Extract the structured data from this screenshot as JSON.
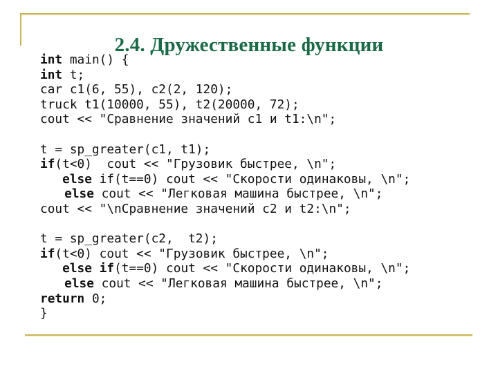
{
  "slide": {
    "title": "2.4. Дружественные функции",
    "accent_color": "#c9b45a",
    "title_color": "#1b6a47"
  },
  "code": {
    "lines": [
      [
        {
          "t": "int",
          "kw": true
        },
        {
          "t": " main() {"
        }
      ],
      [
        {
          "t": "int",
          "kw": true
        },
        {
          "t": " t;"
        }
      ],
      [
        {
          "t": "car c1(6, 55), c2(2, 120);"
        }
      ],
      [
        {
          "t": "truck t1(10000, 55), t2(20000, 72);"
        }
      ],
      [
        {
          "t": "cout << \"Сравнение значений c1 и t1:\\n\";"
        }
      ],
      [],
      [
        {
          "t": "t = sp_greater(c1, t1);"
        }
      ],
      [
        {
          "t": "if",
          "kw": true
        },
        {
          "t": "(t<0)  cout << \"Грузовик быстрее, \\n\";"
        }
      ],
      [
        {
          "t": "   "
        },
        {
          "t": "else",
          "kw": true
        },
        {
          "t": " if(t==0) cout << \"Скорости одинаковы, \\n\";"
        }
      ],
      [
        {
          "t": "   "
        },
        {
          "t": "else",
          "kw": true,
          "shift": true
        },
        {
          "t": " cout << \"Легковая машина быстрее, \\n\";"
        }
      ],
      [
        {
          "t": "cout << \"\\nСравнение значений c2 и t2:\\n\";"
        }
      ],
      [],
      [
        {
          "t": "t = sp_greater(c2,  t2);"
        }
      ],
      [
        {
          "t": "if",
          "kw": true
        },
        {
          "t": "(t<0) cout << \"Грузовик быстрее, \\n\";"
        }
      ],
      [
        {
          "t": "   "
        },
        {
          "t": "else",
          "kw": true
        },
        {
          "t": " "
        },
        {
          "t": "if",
          "kw": true
        },
        {
          "t": "(t==0) cout << \"Скорости одинаковы, \\n\";"
        }
      ],
      [
        {
          "t": "   "
        },
        {
          "t": "else",
          "kw": true,
          "shift": true
        },
        {
          "t": " cout << \"Легковая машина быстрее, \\n\";"
        }
      ],
      [
        {
          "t": "return",
          "kw": true
        },
        {
          "t": " 0;"
        }
      ],
      [
        {
          "t": "}"
        }
      ]
    ]
  }
}
